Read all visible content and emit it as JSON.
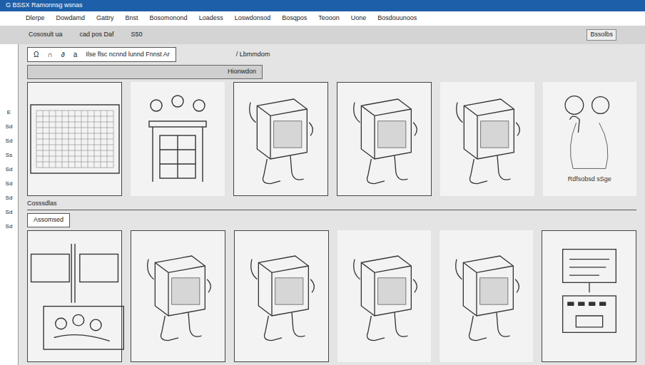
{
  "window": {
    "title": "G BSSX Ramonnsg wsnas"
  },
  "menu": [
    "Dlerpe",
    "Dowdamd",
    "Gattry",
    "Bnst",
    "Bosomonond",
    "Loadess",
    "Loswdonsod",
    "Bosqpos",
    "Teooon",
    "Uone",
    "Bosdouunoos"
  ],
  "toolbar": {
    "line1": "Cososult ua",
    "line2": "cad pos Daf",
    "value": "S50",
    "right_label": "Bssolbs"
  },
  "left_strip": [
    "E",
    "Sd",
    "Sd",
    "Ss",
    "Sd",
    "Sd",
    "Sd",
    "Sd",
    "Sd"
  ],
  "tools": [
    "Ω",
    "∩",
    "∂",
    "a"
  ],
  "tool_text": "Ilse flsc ncnnd lunnd Fnnst Ar",
  "top_hint": "/ Lbmmdom",
  "panel_header": "Hionwdon",
  "sections": [
    {
      "label": "Cosssdlas",
      "frames": [
        {
          "kind": "grid",
          "bordered": true,
          "caption": ""
        },
        {
          "kind": "table",
          "bordered": false,
          "caption": ""
        },
        {
          "kind": "cube",
          "bordered": true,
          "caption": ""
        },
        {
          "kind": "cube",
          "bordered": true,
          "caption": ""
        },
        {
          "kind": "cube",
          "bordered": false,
          "caption": ""
        },
        {
          "kind": "character",
          "bordered": false,
          "caption": "Rdfsobsd sSge"
        }
      ]
    },
    {
      "label": "Assomsed",
      "frames": [
        {
          "kind": "storyboard",
          "bordered": true,
          "caption": ""
        },
        {
          "kind": "cube",
          "bordered": true,
          "caption": ""
        },
        {
          "kind": "cube",
          "bordered": true,
          "caption": ""
        },
        {
          "kind": "cube",
          "bordered": false,
          "caption": ""
        },
        {
          "kind": "cube",
          "bordered": false,
          "caption": ""
        },
        {
          "kind": "screen",
          "bordered": true,
          "caption": ""
        }
      ]
    }
  ]
}
